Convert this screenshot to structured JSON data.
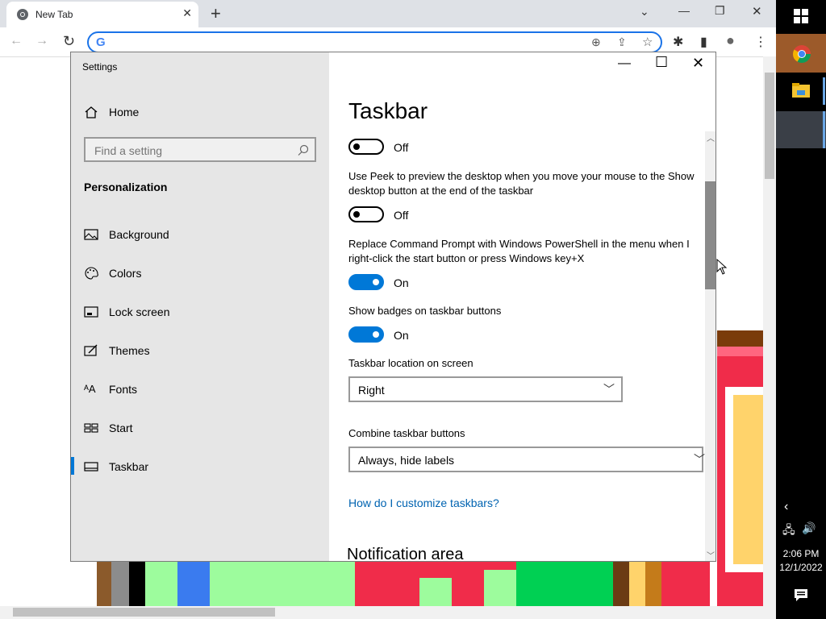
{
  "browser": {
    "tab_title": "New Tab",
    "tab_close": "✕",
    "new_tab": "+",
    "omnibox_value": "",
    "window_controls": [
      "⌄",
      "—",
      "❐",
      "✕"
    ]
  },
  "settings": {
    "app_title": "Settings",
    "home_label": "Home",
    "search_placeholder": "Find a setting",
    "section_heading": "Personalization",
    "nav_items": [
      "Background",
      "Colors",
      "Lock screen",
      "Themes",
      "Fonts",
      "Start",
      "Taskbar"
    ],
    "active_nav": "Taskbar",
    "page_title": "Taskbar",
    "toggle1_state": "Off",
    "peek_desc": "Use Peek to preview the desktop when you move your mouse to the Show desktop button at the end of the taskbar",
    "peek_state": "Off",
    "powershell_desc": "Replace Command Prompt with Windows PowerShell in the menu when I right-click the start button or press Windows key+X",
    "powershell_state": "On",
    "badges_desc": "Show badges on taskbar buttons",
    "badges_state": "On",
    "location_label": "Taskbar location on screen",
    "location_value": "Right",
    "combine_label": "Combine taskbar buttons",
    "combine_value": "Always, hide labels",
    "help_link": "How do I customize taskbars?",
    "notification_heading": "Notification area"
  },
  "taskbar": {
    "time": "2:06 PM",
    "date": "12/1/2022"
  },
  "colors": {
    "accent": "#0078d7",
    "omnibox_border": "#1a73e8",
    "link": "#0063b1"
  }
}
